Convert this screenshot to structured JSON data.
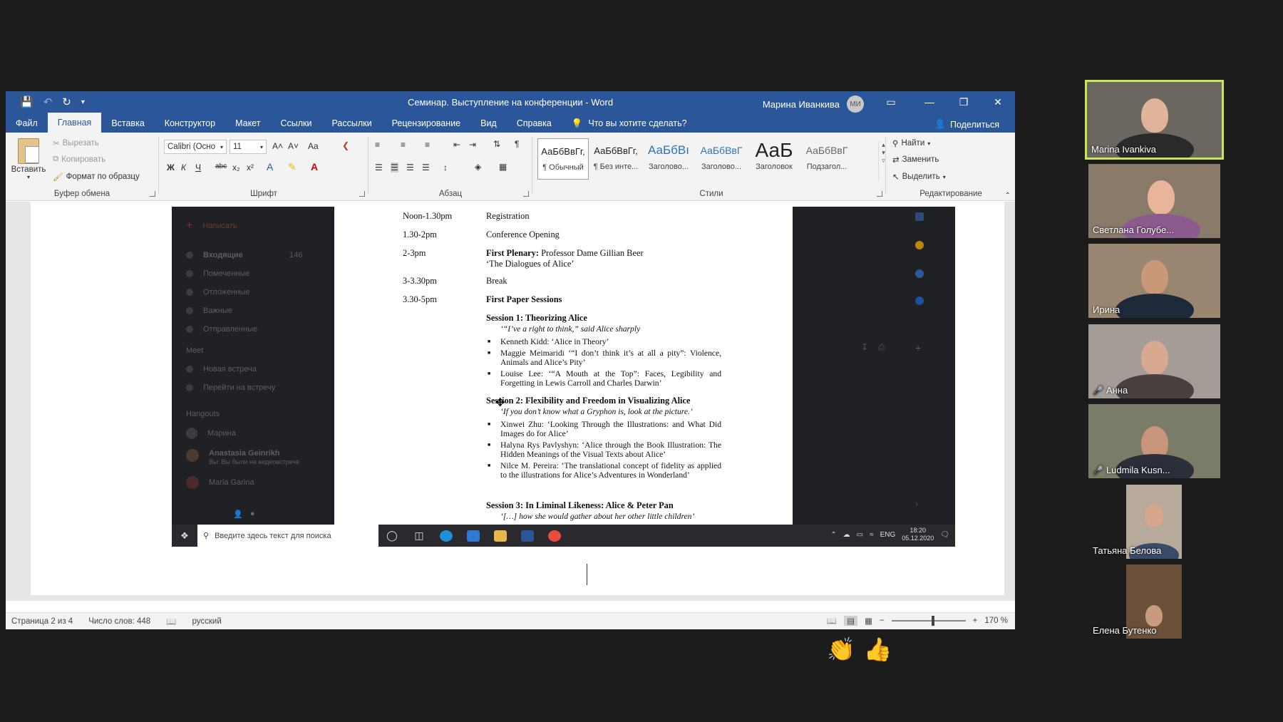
{
  "word": {
    "qat": {
      "save_icon": "save-icon",
      "undo_icon": "undo-icon",
      "redo_icon": "redo-icon",
      "customize_icon": "qat-dropdown-icon"
    },
    "title": "Семинар. Выступление на конференции  -  Word",
    "user_name": "Марина Иванкива",
    "user_initials": "МИ",
    "tabs": [
      {
        "label": "Файл"
      },
      {
        "label": "Главная"
      },
      {
        "label": "Вставка"
      },
      {
        "label": "Конструктор"
      },
      {
        "label": "Макет"
      },
      {
        "label": "Ссылки"
      },
      {
        "label": "Рассылки"
      },
      {
        "label": "Рецензирование"
      },
      {
        "label": "Вид"
      },
      {
        "label": "Справка"
      }
    ],
    "active_tab": "Главная",
    "tell_me": "Что вы хотите сделать?",
    "share": "Поделиться",
    "clipboard": {
      "paste": "Вставить",
      "cut": "Вырезать",
      "copy": "Копировать",
      "format_painter": "Формат по образцу",
      "label": "Буфер обмена"
    },
    "font": {
      "name": "Calibri (Осно",
      "size": "11",
      "label": "Шрифт",
      "bold": "Ж",
      "italic": "К",
      "underline": "Ч",
      "strike": "abc",
      "sub": "x₂",
      "sup": "x²",
      "grow": "A˄",
      "shrink": "A˅",
      "case": "Aa"
    },
    "paragraph": {
      "label": "Абзац"
    },
    "styles": {
      "label": "Стили",
      "items": [
        {
          "sample": "АаБбВвГг,",
          "name": "¶ Обычный"
        },
        {
          "sample": "АаБбВвГг,",
          "name": "¶ Без инте..."
        },
        {
          "sample": "АаБбВı",
          "name": "Заголово..."
        },
        {
          "sample": "АаБбВвГ",
          "name": "Заголово..."
        },
        {
          "sample": "АаБ",
          "name": "Заголовок"
        },
        {
          "sample": "АаБбВвГ",
          "name": "Подзагол..."
        }
      ]
    },
    "editing": {
      "label": "Редактирование",
      "find": "Найти",
      "replace": "Заменить",
      "select": "Выделить"
    },
    "status": {
      "page": "Страница 2 из 4",
      "words": "Число слов: 448",
      "language": "русский",
      "zoom": "170 %"
    }
  },
  "shared_screen": {
    "gmail": {
      "compose": "Написать",
      "items": [
        {
          "label": "Входящие",
          "count": "146"
        },
        {
          "label": "Помеченные"
        },
        {
          "label": "Отложенные"
        },
        {
          "label": "Важные"
        },
        {
          "label": "Отправленные"
        }
      ],
      "meet": {
        "header": "Meet",
        "new_meeting": "Новая встреча",
        "join": "Перейти на встречу"
      },
      "hangouts": {
        "header": "Hangouts",
        "me": "Марина",
        "contact1": "Anastasia Geinrikh",
        "contact1_status": "Вы: Вы были на видеовстрече",
        "contact2": "Maria Garina"
      }
    },
    "program": [
      {
        "time": "Noon-1.30pm",
        "title": "Registration"
      },
      {
        "time": "1.30-2pm",
        "title": "Conference Opening"
      },
      {
        "time": "2-3pm",
        "bold": "First Plenary:",
        "title": " Professor Dame Gillian Beer",
        "subtitle": "‘The Dialogues of Alice’"
      },
      {
        "time": "3-3.30pm",
        "title": "Break"
      },
      {
        "time": "3.30-5pm",
        "bold": "First Paper Sessions",
        "title": ""
      }
    ],
    "sessions": [
      {
        "title": "Session 1: Theorizing Alice",
        "quote": "‘“I’ve a right to think,” said Alice sharply",
        "items": [
          "Kenneth Kidd: ‘Alice in Theory’",
          "Maggie Meimaridi ‘“I don’t think it’s at all a pity”: Violence, Animals and Alice’s Pity’",
          "Louise Lee: ‘“A Mouth at the Top”: Faces, Legibility and Forgetting in Lewis Carroll and Charles Darwin’"
        ]
      },
      {
        "title": "Session 2: Flexibility and Freedom in Visualizing Alice",
        "quote": "‘If you don’t know what a Gryphon is, look at the picture.’",
        "items": [
          "Xinwei Zhu: ‘Looking Through the Illustrations: and What Did Images do for Alice’",
          "Halyna Rys Pavlyshyn: ‘Alice through the Book Illustration: The Hidden Meanings of the Visual Texts about Alice’",
          "Nilce M. Pereira: ‘The translational concept of fidelity as applied to the illustrations for Alice’s Adventures in Wonderland’"
        ]
      },
      {
        "title": "Session 3: In Liminal Likeness: Alice & Peter Pan",
        "quote": "‘[…] how she would gather about her other little children’",
        "items": []
      }
    ],
    "taskbar": {
      "search_placeholder": "Введите здесь текст для поиска",
      "language": "ENG",
      "time": "18:20",
      "date": "05.12.2020"
    }
  },
  "participants": [
    {
      "name": "Marina Ivankiva",
      "active": true,
      "muted": false
    },
    {
      "name": "Светлана Голубе...",
      "active": false,
      "muted": false
    },
    {
      "name": "Ирина",
      "active": false,
      "muted": false
    },
    {
      "name": "Анна",
      "active": false,
      "muted": true
    },
    {
      "name": "Ludmila Kusn...",
      "active": false,
      "muted": true
    },
    {
      "name": "Татьяна Белова",
      "active": false,
      "muted": false
    },
    {
      "name": "Елена Бутенко",
      "active": false,
      "muted": false
    }
  ],
  "reactions": [
    "👏",
    "👍"
  ],
  "colors": {
    "word_blue": "#2b579a",
    "active_speaker": "#c8e65a",
    "mute_red": "#e5463b"
  }
}
